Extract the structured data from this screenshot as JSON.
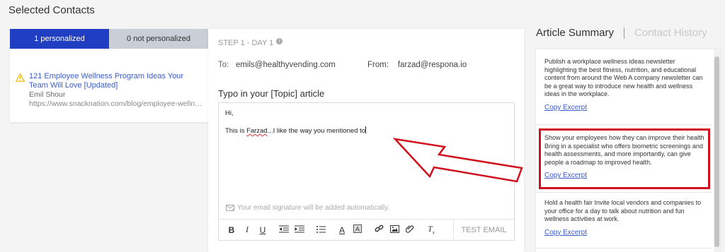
{
  "page": {
    "heading": "Selected Contacts"
  },
  "contacts_panel": {
    "tabs": [
      {
        "label": "1 personalized",
        "active": true
      },
      {
        "label": "0 not personalized",
        "active": false
      }
    ],
    "items": [
      {
        "title": "121 Employee Wellness Program Ideas Your Team Will Love [Updated]",
        "name": "Emil Shour",
        "url": "https://www.snacknation.com/blog/employee-wellness-program-ideas/",
        "status_icon": "warning-icon"
      }
    ]
  },
  "email": {
    "step": "STEP 1 - DAY 1",
    "to_label": "To:",
    "to_value": "emils@healthyvending.com",
    "from_label": "From:",
    "from_value": "farzad@respona.io",
    "subject": "Typo in your [Topic] article",
    "body_greeting": "Hi,",
    "body_text_before": "This is ",
    "body_text_misspelled": "Farzad",
    "body_text_after": "...I like the way you mentioned to",
    "signature_note": "Your email signature will be added automatically.",
    "test_button": "TEST EMAIL",
    "toolbar": [
      "bold",
      "italic",
      "underline",
      "outdent",
      "indent",
      "list",
      "text-color",
      "highlight",
      "link",
      "image",
      "attachment",
      "clear-format"
    ]
  },
  "right_panel": {
    "tabs": [
      {
        "label": "Article Summary",
        "active": true
      },
      {
        "label": "Contact History",
        "active": false
      }
    ],
    "excerpts": [
      {
        "text": "Publish a workplace wellness ideas newsletter highlighting the best fitness, nutrition, and educational content from around the Web A company newsletter can be a great way to introduce new health and wellness ideas in the workplace.",
        "link": "Copy Excerpt",
        "highlighted": false
      },
      {
        "text": "Show your employees how they can improve their health Bring in a specialist who offers biometric screenings and health assessments, and more importantly, can give people a roadmap to improved health.",
        "link": "Copy Excerpt",
        "highlighted": true
      },
      {
        "text": "Hold a health fair Invite local vendors and companies to your office for a day to talk about nutrition and fun wellness activities at work.",
        "link": "Copy Excerpt",
        "highlighted": false
      }
    ]
  },
  "colors": {
    "accent": "#1f3ec2",
    "link": "#3b5bcc",
    "annotation_red": "#d0101c",
    "warning": "#f0b400"
  }
}
